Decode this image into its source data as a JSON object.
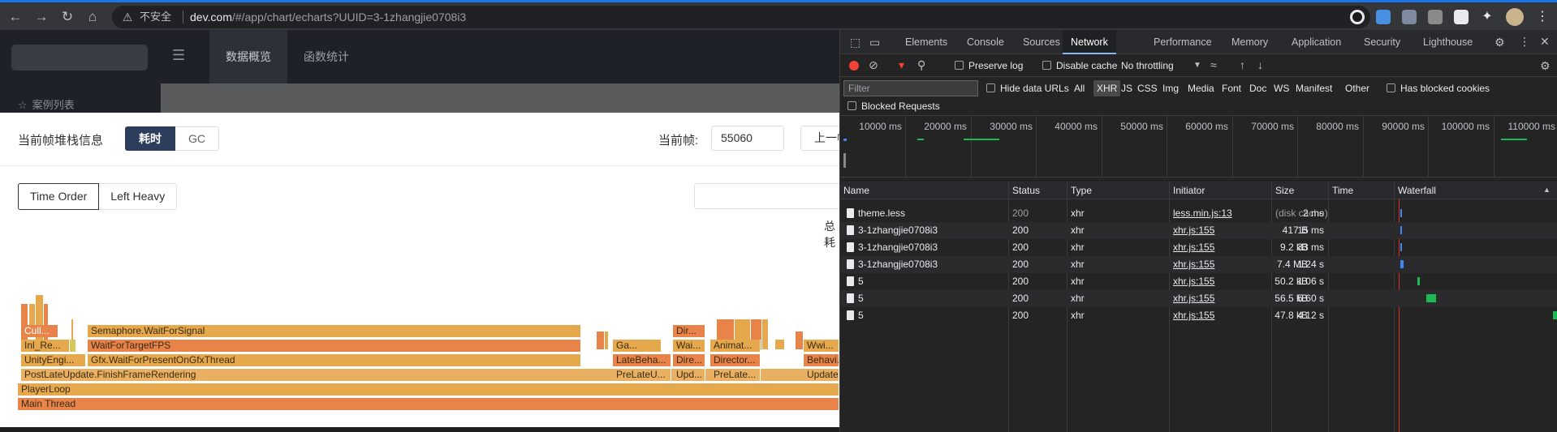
{
  "browser": {
    "security_label": "不安全",
    "url_host": "dev.com",
    "url_path": "/#/app/chart/echarts?UUID=3-1zhangjie0708i3"
  },
  "app": {
    "tabs": [
      "数据概览",
      "函数统计"
    ],
    "sidebar_item": "案例列表"
  },
  "dialog": {
    "title": "当前帧堆栈信息",
    "mode_buttons": [
      "耗时",
      "GC"
    ],
    "frame_label": "当前帧:",
    "frame_value": "55060",
    "prev_button": "上一帧",
    "order_buttons": [
      "Time Order",
      "Left Heavy"
    ],
    "total_text": "总耗"
  },
  "flame": [
    {
      "label": "Main Thread"
    },
    {
      "label": "PlayerLoop"
    },
    {
      "label": "PostLateUpdate.FinishFrameRendering"
    },
    {
      "label": "UnityEngi..."
    },
    {
      "label": "Gfx.WaitForPresentOnGfxThread"
    },
    {
      "label": "LateBeha..."
    },
    {
      "label": "Dire..."
    },
    {
      "label": "Director..."
    },
    {
      "label": "Behavi..."
    },
    {
      "label": "Inl_Re..."
    },
    {
      "label": "WaitForTargetFPS"
    },
    {
      "label": "Ga..."
    },
    {
      "label": "Wai..."
    },
    {
      "label": "Animat..."
    },
    {
      "label": "Wwi..."
    },
    {
      "label": "Cull..."
    },
    {
      "label": "Semaphore.WaitForSignal"
    },
    {
      "label": "Dir..."
    },
    {
      "label": "PreLateU..."
    },
    {
      "label": "Upd..."
    },
    {
      "label": "PreLate..."
    },
    {
      "label": "Update..."
    }
  ],
  "devtools": {
    "tabs": [
      "Elements",
      "Console",
      "Sources",
      "Network",
      "Performance",
      "Memory",
      "Application",
      "Security",
      "Lighthouse"
    ],
    "active_tab": "Network",
    "toolbar": {
      "preserve_log": "Preserve log",
      "disable_cache": "Disable cache",
      "throttling": "No throttling"
    },
    "filter_placeholder": "Filter",
    "hide_data_urls": "Hide data URLs",
    "type_filters": [
      "All",
      "XHR",
      "JS",
      "CSS",
      "Img",
      "Media",
      "Font",
      "Doc",
      "WS",
      "Manifest",
      "Other"
    ],
    "active_type": "XHR",
    "has_blocked_cookies": "Has blocked cookies",
    "blocked_requests": "Blocked Requests",
    "overview_ticks": [
      "10000 ms",
      "20000 ms",
      "30000 ms",
      "40000 ms",
      "50000 ms",
      "60000 ms",
      "70000 ms",
      "80000 ms",
      "90000 ms",
      "100000 ms",
      "110000 ms"
    ],
    "columns": [
      "Name",
      "Status",
      "Type",
      "Initiator",
      "Size",
      "Time",
      "Waterfall"
    ],
    "rows": [
      {
        "name": "theme.less",
        "status": "200",
        "type": "xhr",
        "initiator": "less.min.js:13",
        "size": "(disk cache)",
        "time": "2 ms"
      },
      {
        "name": "3-1zhangjie0708i3",
        "status": "200",
        "type": "xhr",
        "initiator": "xhr.js:155",
        "size": "417 B",
        "time": "15 ms"
      },
      {
        "name": "3-1zhangjie0708i3",
        "status": "200",
        "type": "xhr",
        "initiator": "xhr.js:155",
        "size": "9.2 kB",
        "time": "33 ms"
      },
      {
        "name": "3-1zhangjie0708i3",
        "status": "200",
        "type": "xhr",
        "initiator": "xhr.js:155",
        "size": "7.4 MB",
        "time": "1.24 s"
      },
      {
        "name": "5",
        "status": "200",
        "type": "xhr",
        "initiator": "xhr.js:155",
        "size": "50.2 kB",
        "time": "1.06 s"
      },
      {
        "name": "5",
        "status": "200",
        "type": "xhr",
        "initiator": "xhr.js:155",
        "size": "56.5 kB",
        "time": "5.60 s"
      },
      {
        "name": "5",
        "status": "200",
        "type": "xhr",
        "initiator": "xhr.js:155",
        "size": "47.8 kB",
        "time": "4.12 s"
      }
    ]
  },
  "colors": {
    "accent": "#1a73e8",
    "flame_dark": "#e8844a",
    "flame_light": "#e6a84c",
    "mode_active": "#2c3e5c"
  }
}
